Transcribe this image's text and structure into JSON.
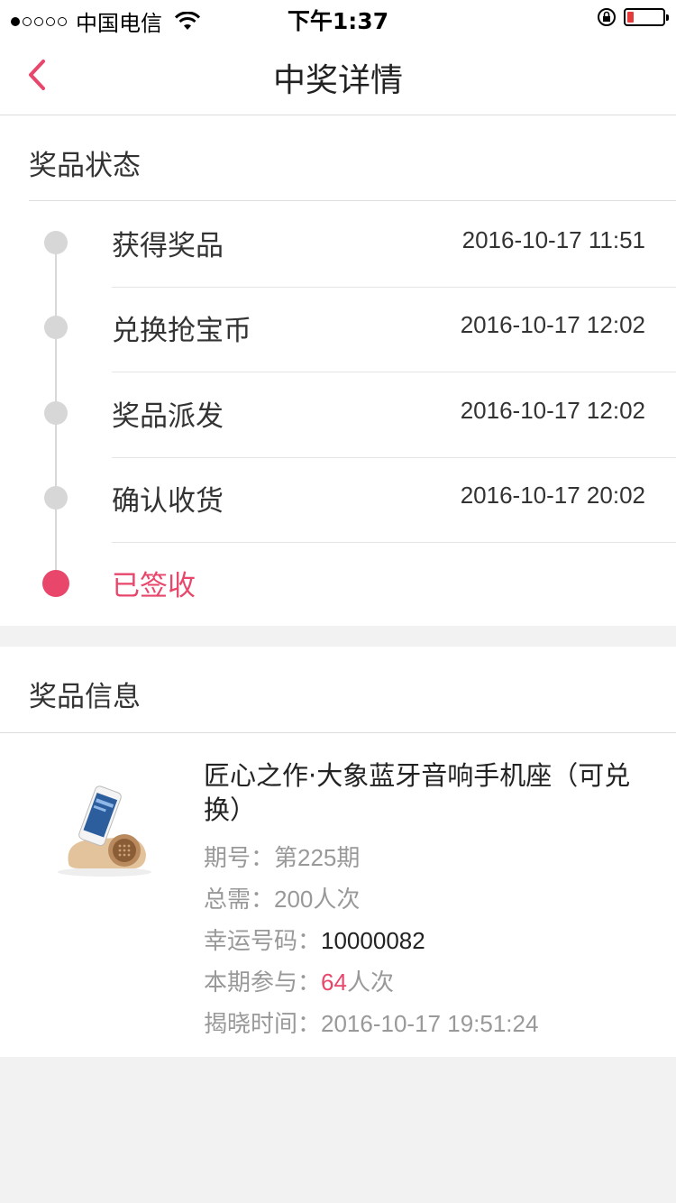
{
  "status_bar": {
    "carrier": "中国电信",
    "time": "下午1:37"
  },
  "nav": {
    "title": "中奖详情"
  },
  "prize_status": {
    "title": "奖品状态",
    "steps": [
      {
        "label": "获得奖品",
        "time": "2016-10-17 11:51"
      },
      {
        "label": "兑换抢宝币",
        "time": "2016-10-17 12:02"
      },
      {
        "label": "奖品派发",
        "time": "2016-10-17 12:02"
      },
      {
        "label": "确认收货",
        "time": "2016-10-17 20:02"
      },
      {
        "label": "已签收",
        "time": ""
      }
    ]
  },
  "prize_info": {
    "title": "奖品信息",
    "product_name": "匠心之作·大象蓝牙音响手机座（可兑换）",
    "period_label": "期号：",
    "period_value": "第225期",
    "total_label": "总需：",
    "total_value": "200人次",
    "lucky_label": "幸运号码：",
    "lucky_value": "10000082",
    "participate_label": "本期参与：",
    "participate_count": "64",
    "participate_unit": "人次",
    "reveal_label": "揭晓时间：",
    "reveal_value": "2016-10-17 19:51:24"
  },
  "colors": {
    "accent": "#e8466b",
    "inactive_dot": "#d7d7d7"
  }
}
